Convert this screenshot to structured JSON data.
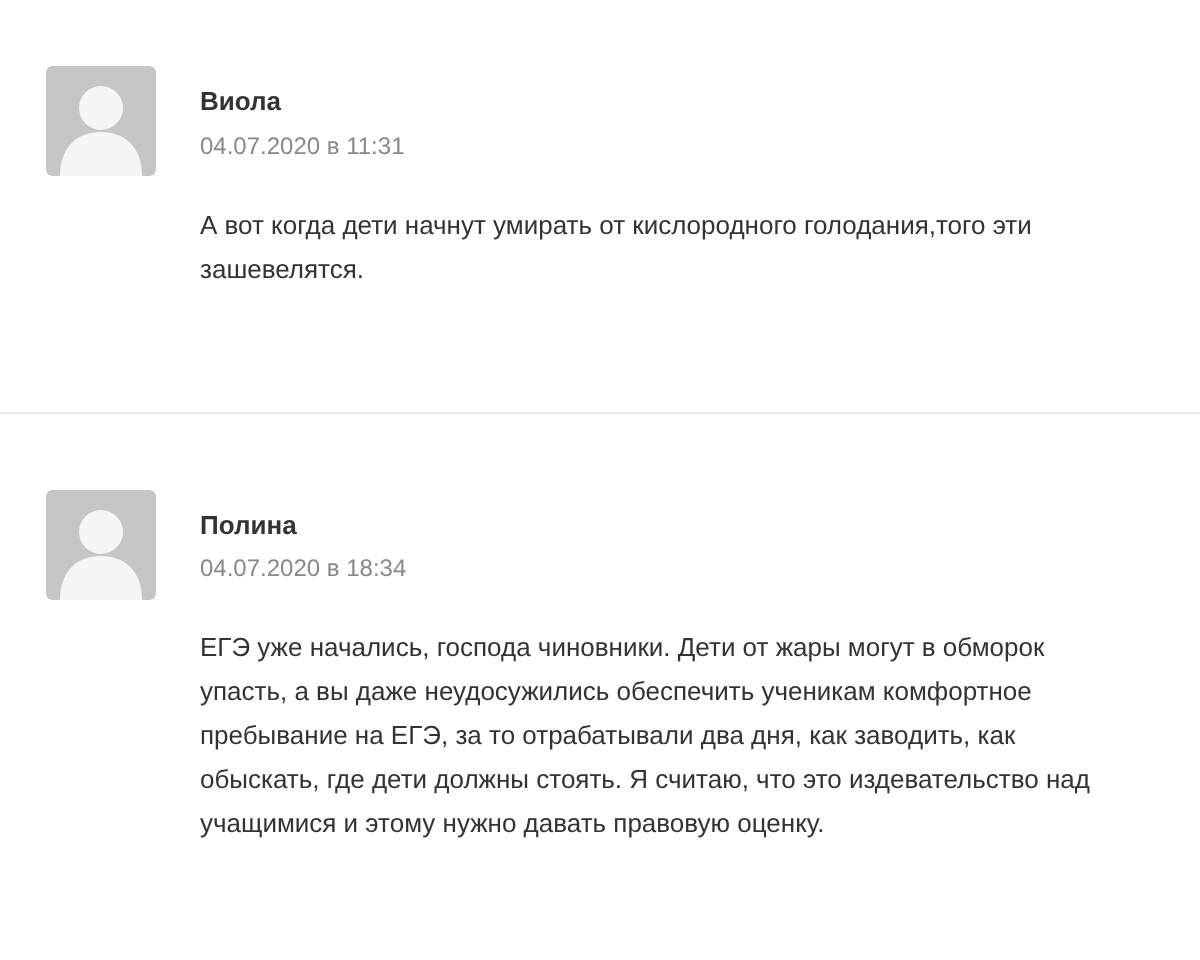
{
  "comments": [
    {
      "author": "Виола",
      "date": "04.07.2020 в 11:31",
      "text": "А вот когда дети начнут умирать от кислородного голодания,того эти зашевелятся."
    },
    {
      "author": "Полина",
      "date": "04.07.2020 в 18:34",
      "text": "ЕГЭ уже начались, господа чиновники. Дети от жары могут в обморок упасть, а вы даже неудосужились обеспечить ученикам комфортное пребывание на ЕГЭ, за то отрабатывали два дня, как заводить, как обыскать, где дети должны стоять. Я считаю, что это издевательство над учащимися и этому нужно давать правовую оценку."
    }
  ]
}
